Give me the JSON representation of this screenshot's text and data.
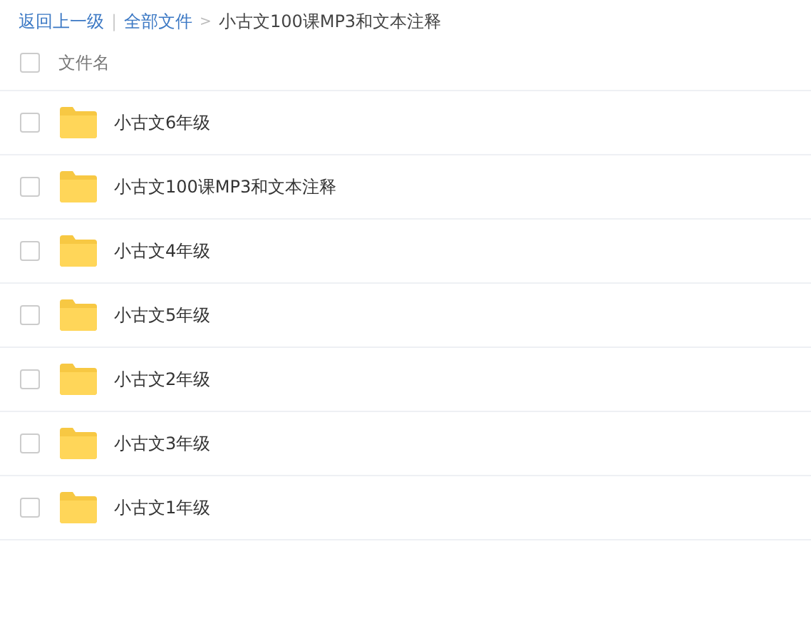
{
  "breadcrumb": {
    "back": "返回上一级",
    "separator": "|",
    "root": "全部文件",
    "arrow": ">",
    "current": "小古文100课MP3和文本注释"
  },
  "header": {
    "checked": false,
    "label": "文件名"
  },
  "files": [
    {
      "name": "小古文6年级",
      "checked": false
    },
    {
      "name": "小古文100课MP3和文本注释",
      "checked": false
    },
    {
      "name": "小古文4年级",
      "checked": false
    },
    {
      "name": "小古文5年级",
      "checked": false
    },
    {
      "name": "小古文2年级",
      "checked": false
    },
    {
      "name": "小古文3年级",
      "checked": false
    },
    {
      "name": "小古文1年级",
      "checked": false
    }
  ]
}
